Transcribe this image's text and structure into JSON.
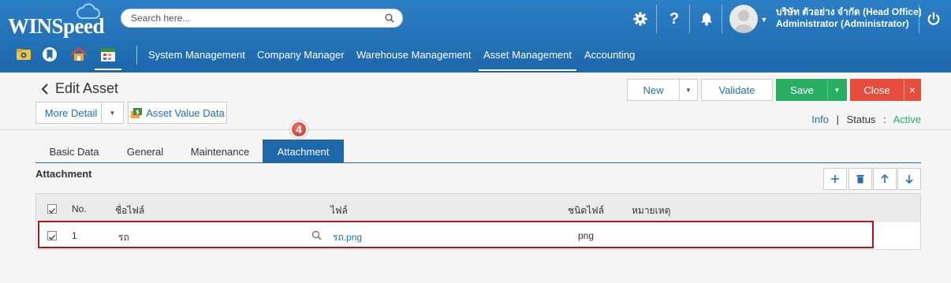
{
  "app": {
    "logo": "WINSpeed"
  },
  "search": {
    "placeholder": "Search here..."
  },
  "user": {
    "company": "บริษัท ตัวอย่าง จำกัด (Head Office)",
    "name": "Administrator (Administrator)"
  },
  "menu": [
    {
      "label": "System Management"
    },
    {
      "label": "Company Manager"
    },
    {
      "label": "Warehouse Management"
    },
    {
      "label": "Asset Management"
    },
    {
      "label": "Accounting"
    }
  ],
  "page": {
    "title": "Edit Asset",
    "more_detail": "More Detail",
    "asset_value": "Asset Value Data",
    "new": "New",
    "validate": "Validate",
    "save": "Save",
    "close": "Close",
    "info": "Info",
    "status_label": "Status",
    "status_value": "Active"
  },
  "tabs": [
    {
      "label": "Basic Data"
    },
    {
      "label": "General"
    },
    {
      "label": "Maintenance"
    },
    {
      "label": "Attachment"
    }
  ],
  "step_badge": "4",
  "attachment": {
    "title": "Attachment",
    "columns": {
      "no": "No.",
      "filename": "ชื่อไฟล์",
      "file": "ไฟล์",
      "filetype": "ชนิดไฟล์",
      "remark": "หมายเหตุ"
    },
    "rows": [
      {
        "no": "1",
        "filename": "รถ",
        "file": "รถ.png",
        "filetype": "png",
        "remark": ""
      }
    ]
  }
}
